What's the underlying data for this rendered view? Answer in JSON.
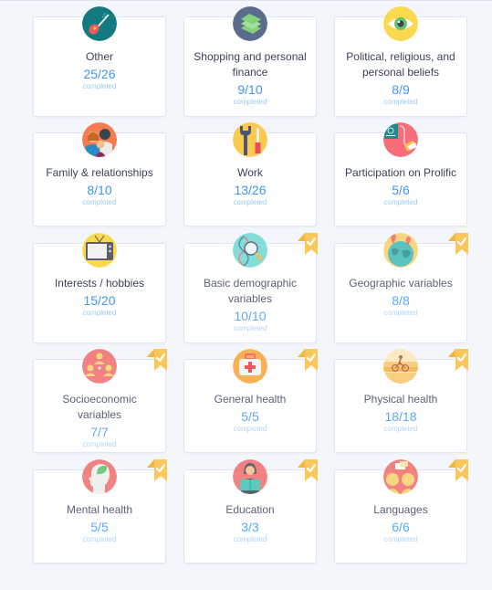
{
  "colors": {
    "background": "#f3f6fb",
    "card": "#ffffff",
    "title_text": "#3a4256",
    "count_text": "#3f96f0",
    "completed_text": "#9cc9f3",
    "badge": "#fbc65a"
  },
  "categories": [
    {
      "title": "Other",
      "count": "25/26",
      "sublabel": "completed",
      "icon": "guitar-icon",
      "done": false
    },
    {
      "title": "Shopping and personal finance",
      "count": "9/10",
      "sublabel": "completed",
      "icon": "money-stack-icon",
      "done": false
    },
    {
      "title": "Political, religious, and personal beliefs",
      "count": "8/9",
      "sublabel": "completed",
      "icon": "eye-icon",
      "done": false
    },
    {
      "title": "Family & relationships",
      "count": "8/10",
      "sublabel": "completed",
      "icon": "family-icon",
      "done": false
    },
    {
      "title": "Work",
      "count": "13/26",
      "sublabel": "completed",
      "icon": "tools-icon",
      "done": false
    },
    {
      "title": "Participation on Prolific",
      "count": "5/6",
      "sublabel": "completed",
      "icon": "passport-icon",
      "done": false
    },
    {
      "title": "Interests / hobbies",
      "count": "15/20",
      "sublabel": "completed",
      "icon": "tv-icon",
      "done": false
    },
    {
      "title": "Basic demographic variables",
      "count": "10/10",
      "sublabel": "completed",
      "icon": "dna-magnifier-icon",
      "done": true
    },
    {
      "title": "Geographic variables",
      "count": "8/8",
      "sublabel": "completed",
      "icon": "globe-pins-icon",
      "done": true
    },
    {
      "title": "Socioeconomic variables",
      "count": "7/7",
      "sublabel": "completed",
      "icon": "people-network-icon",
      "done": true
    },
    {
      "title": "General health",
      "count": "5/5",
      "sublabel": "completed",
      "icon": "first-aid-kit-icon",
      "done": true
    },
    {
      "title": "Physical health",
      "count": "18/18",
      "sublabel": "completed",
      "icon": "cyclist-icon",
      "done": true
    },
    {
      "title": "Mental health",
      "count": "5/5",
      "sublabel": "completed",
      "icon": "head-leaf-icon",
      "done": true
    },
    {
      "title": "Education",
      "count": "3/3",
      "sublabel": "completed",
      "icon": "reader-icon",
      "done": true
    },
    {
      "title": "Languages",
      "count": "6/6",
      "sublabel": "completed",
      "icon": "speech-heads-icon",
      "done": true
    }
  ]
}
